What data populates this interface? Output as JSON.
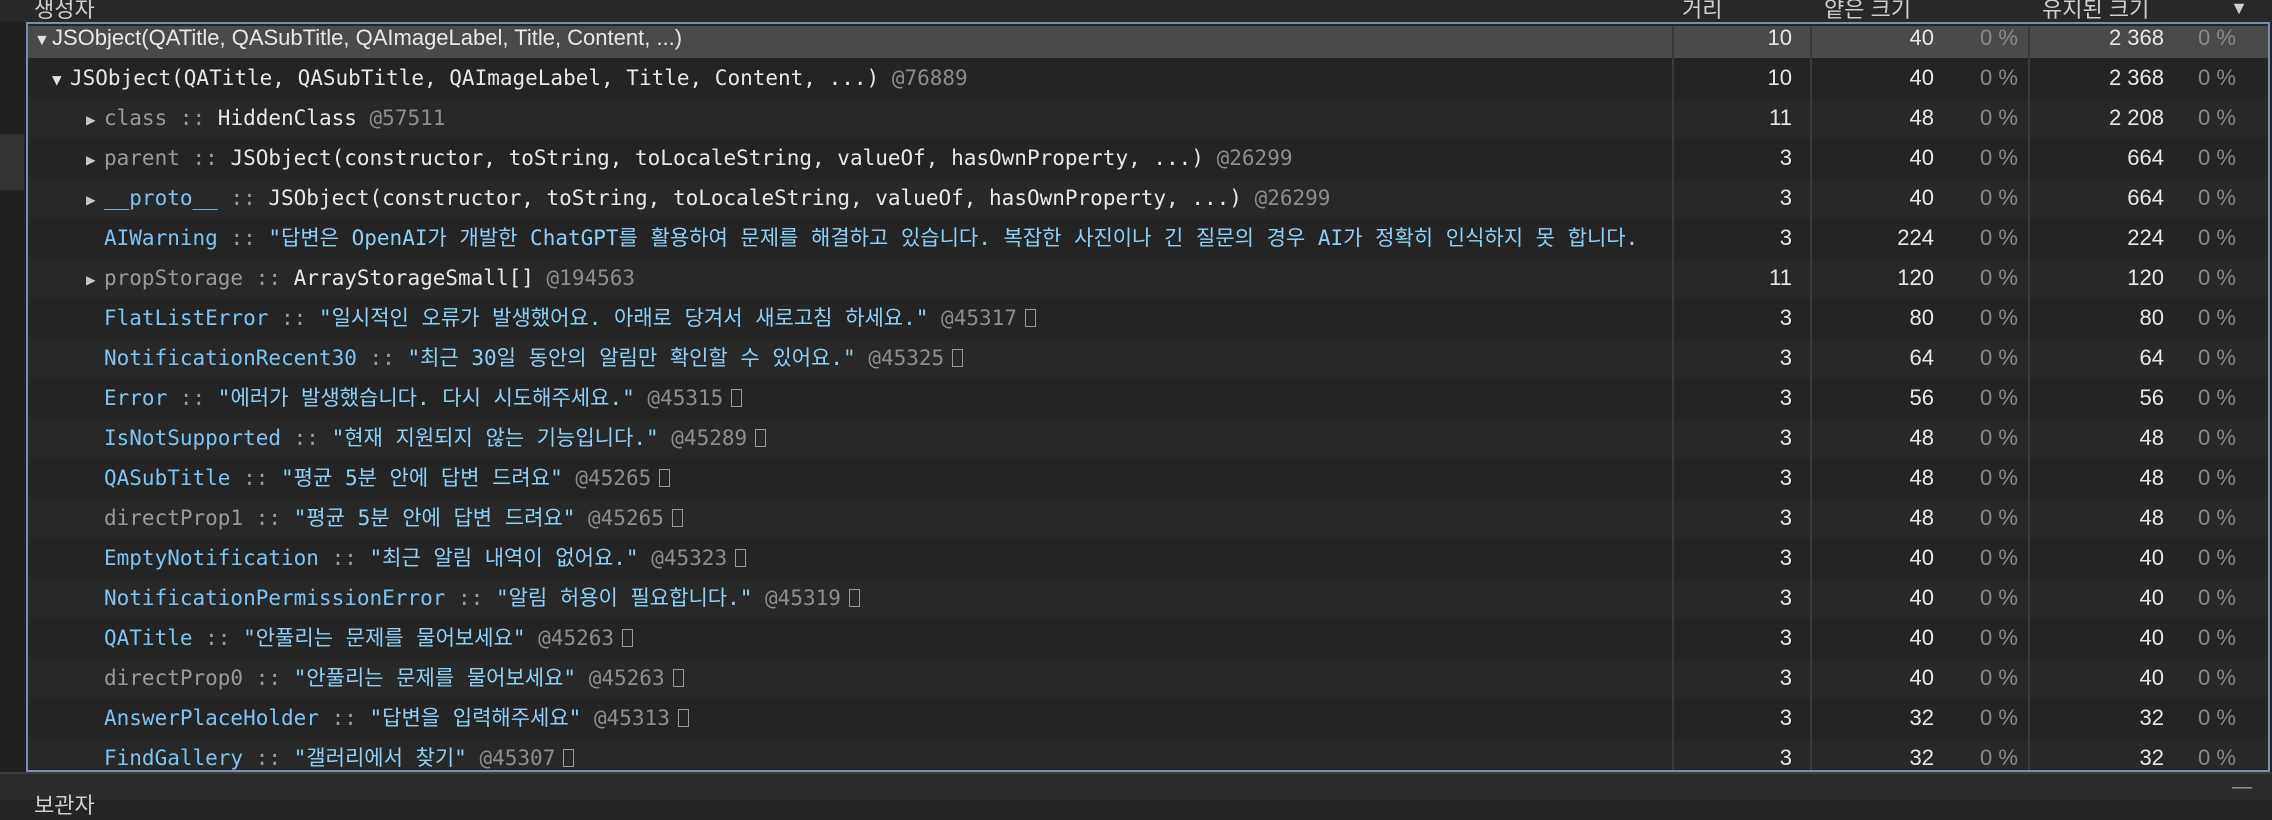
{
  "header": {
    "columns": [
      {
        "label": "생성자"
      },
      {
        "label": "거리"
      },
      {
        "label": "얕은 크기"
      },
      {
        "label": "유지된 크기"
      }
    ],
    "sort_indicator": "▼"
  },
  "rows": [
    {
      "caret": "open",
      "name_text": "JSObject(QATitle, QASubTitle, QAImageLabel, Title, Content, ...)",
      "distance": "10",
      "shallow": "40",
      "shallow_pct": "0 %",
      "retained": "2 368",
      "retained_pct": "0 %"
    },
    {
      "caret": "open",
      "name_text": "JSObject(QATitle, QASubTitle, QAImageLabel, Title, Content, ...)",
      "id": "@76889",
      "distance": "10",
      "shallow": "40",
      "shallow_pct": "0 %",
      "retained": "2 368",
      "retained_pct": "0 %"
    },
    {
      "caret": "closed",
      "key": "class",
      "value": "HiddenClass",
      "id": "@57511",
      "distance": "11",
      "shallow": "48",
      "shallow_pct": "0 %",
      "retained": "2 208",
      "retained_pct": "0 %"
    },
    {
      "caret": "closed",
      "key": "parent",
      "value": "JSObject(constructor, toString, toLocaleString, valueOf, hasOwnProperty, ...)",
      "id": "@26299",
      "distance": "3",
      "shallow": "40",
      "shallow_pct": "0 %",
      "retained": "664",
      "retained_pct": "0 %"
    },
    {
      "caret": "closed",
      "key": "__proto__",
      "value": "JSObject(constructor, toString, toLocaleString, valueOf, hasOwnProperty, ...)",
      "id": "@26299",
      "distance": "3",
      "shallow": "40",
      "shallow_pct": "0 %",
      "retained": "664",
      "retained_pct": "0 %"
    },
    {
      "caret": "none",
      "key": "AIWarning",
      "string": "\"답변은 OpenAI가 개발한 ChatGPT를 활용하여 문제를 해결하고 있습니다. 복잡한 사진이나 긴 질문의 경우 AI가 정확히 인식하지 못 합니다.",
      "distance": "3",
      "shallow": "224",
      "shallow_pct": "0 %",
      "retained": "224",
      "retained_pct": "0 %"
    },
    {
      "caret": "closed",
      "key": "propStorage",
      "value": "ArrayStorageSmall[]",
      "id": "@194563",
      "distance": "11",
      "shallow": "120",
      "shallow_pct": "0 %",
      "retained": "120",
      "retained_pct": "0 %"
    },
    {
      "caret": "none",
      "key": "FlatListError",
      "string": "\"일시적인 오류가 발생했어요. 아래로 당겨서 새로고침 하세요.\"",
      "id": "@45317",
      "distance": "3",
      "shallow": "80",
      "shallow_pct": "0 %",
      "retained": "80",
      "retained_pct": "0 %"
    },
    {
      "caret": "none",
      "key": "NotificationRecent30",
      "string": "\"최근 30일 동안의 알림만 확인할 수 있어요.\"",
      "id": "@45325",
      "distance": "3",
      "shallow": "64",
      "shallow_pct": "0 %",
      "retained": "64",
      "retained_pct": "0 %"
    },
    {
      "caret": "none",
      "key": "Error",
      "string": "\"에러가 발생했습니다. 다시 시도해주세요.\"",
      "id": "@45315",
      "distance": "3",
      "shallow": "56",
      "shallow_pct": "0 %",
      "retained": "56",
      "retained_pct": "0 %"
    },
    {
      "caret": "none",
      "key": "IsNotSupported",
      "string": "\"현재 지원되지 않는 기능입니다.\"",
      "id": "@45289",
      "distance": "3",
      "shallow": "48",
      "shallow_pct": "0 %",
      "retained": "48",
      "retained_pct": "0 %"
    },
    {
      "caret": "none",
      "key": "QASubTitle",
      "string": "\"평균 5분 안에 답변 드려요\"",
      "id": "@45265",
      "distance": "3",
      "shallow": "48",
      "shallow_pct": "0 %",
      "retained": "48",
      "retained_pct": "0 %"
    },
    {
      "caret": "none",
      "key": "directProp1",
      "string": "\"평균 5분 안에 답변 드려요\"",
      "id": "@45265",
      "distance": "3",
      "shallow": "48",
      "shallow_pct": "0 %",
      "retained": "48",
      "retained_pct": "0 %"
    },
    {
      "caret": "none",
      "key": "EmptyNotification",
      "string": "\"최근 알림 내역이 없어요.\"",
      "id": "@45323",
      "distance": "3",
      "shallow": "40",
      "shallow_pct": "0 %",
      "retained": "40",
      "retained_pct": "0 %"
    },
    {
      "caret": "none",
      "key": "NotificationPermissionError",
      "string": "\"알림 허용이 필요합니다.\"",
      "id": "@45319",
      "distance": "3",
      "shallow": "40",
      "shallow_pct": "0 %",
      "retained": "40",
      "retained_pct": "0 %"
    },
    {
      "caret": "none",
      "key": "QATitle",
      "string": "\"안풀리는 문제를 물어보세요\"",
      "id": "@45263",
      "distance": "3",
      "shallow": "40",
      "shallow_pct": "0 %",
      "retained": "40",
      "retained_pct": "0 %"
    },
    {
      "caret": "none",
      "key": "directProp0",
      "string": "\"안풀리는 문제를 물어보세요\"",
      "id": "@45263",
      "distance": "3",
      "shallow": "40",
      "shallow_pct": "0 %",
      "retained": "40",
      "retained_pct": "0 %"
    },
    {
      "caret": "none",
      "key": "AnswerPlaceHolder",
      "string": "\"답변을 입력해주세요\"",
      "id": "@45313",
      "distance": "3",
      "shallow": "32",
      "shallow_pct": "0 %",
      "retained": "32",
      "retained_pct": "0 %"
    },
    {
      "caret": "none",
      "key": "FindGallery",
      "string": "\"갤러리에서 찾기\"",
      "id": "@45307",
      "distance": "3",
      "shallow": "32",
      "shallow_pct": "0 %",
      "retained": "32",
      "retained_pct": "0 %"
    }
  ],
  "footer": {
    "label": "보관자",
    "collapse_glyph": "—"
  }
}
